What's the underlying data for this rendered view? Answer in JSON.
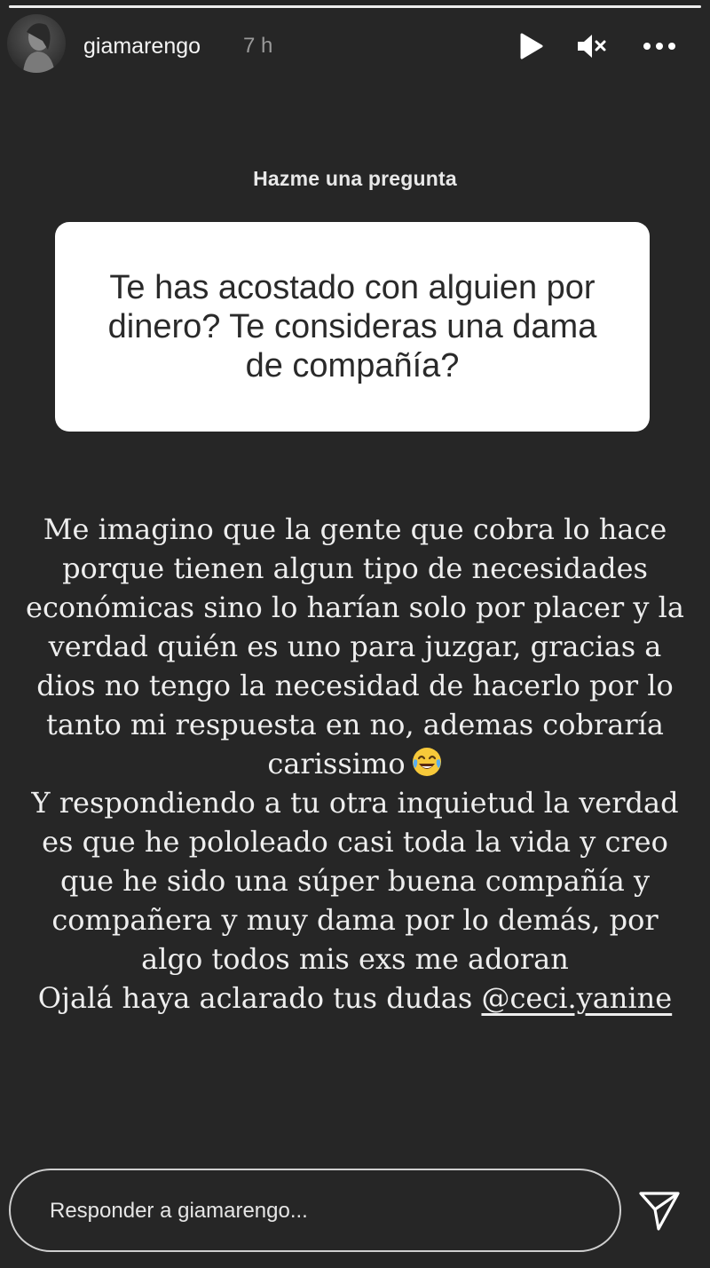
{
  "story": {
    "progress": 1.0
  },
  "header": {
    "username": "giamarengo",
    "timestamp": "7 h",
    "icons": [
      "avatar",
      "play-icon",
      "mute-icon",
      "more-icon"
    ]
  },
  "question_sticker": {
    "label": "Hazme una pregunta",
    "question": "Te has acostado con alguien por dinero? Te consideras una dama de compañía?"
  },
  "answer": {
    "paragraph1": "Me imagino que la gente que cobra lo hace porque tienen algun tipo de necesidades económicas sino lo harían solo por placer y la verdad quién es uno para juzgar, gracias a dios no tengo la necesidad de hacerlo por lo tanto mi respuesta en no, ademas cobraría carissimo",
    "emoji": "face-with-tears-of-joy",
    "paragraph2": "Y respondiendo a tu otra inquietud la verdad es que he pololeado casi toda la vida y creo que he sido una súper buena compañía y compañera y muy dama por lo demás, por algo todos mis exs me adoran",
    "closing": "Ojalá haya aclarado tus dudas",
    "mention": "@ceci.yanine"
  },
  "reply": {
    "placeholder": "Responder a giamarengo...",
    "send_icon": "paper-plane-icon"
  },
  "colors": {
    "background": "#262626",
    "card": "#ffffff",
    "text": "#eeeeee"
  }
}
